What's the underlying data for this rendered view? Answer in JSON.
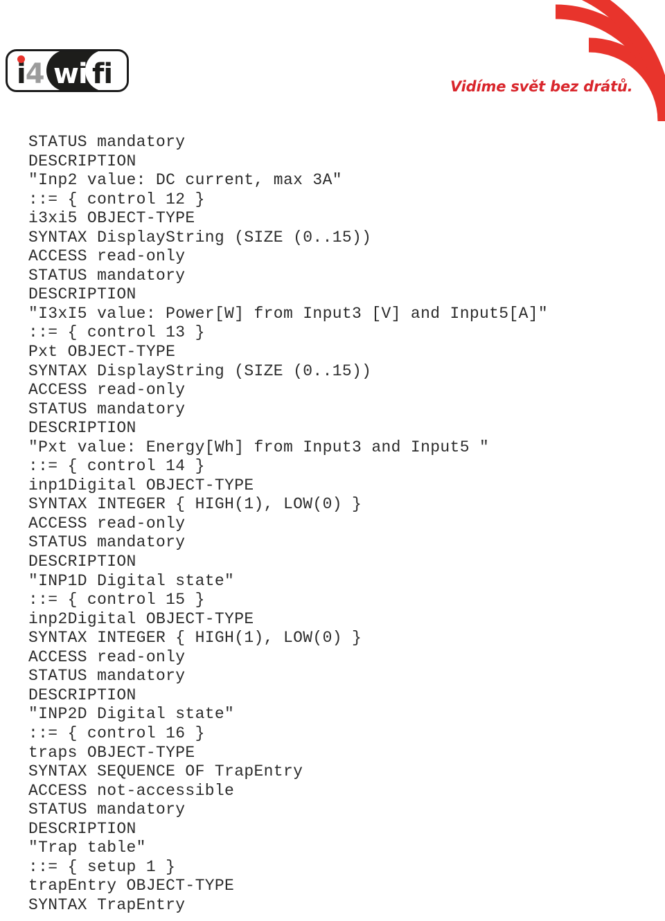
{
  "header": {
    "logo": {
      "name": "i4wifi-logo",
      "part_i4": "i4",
      "part_wi": "wi",
      "part_fi": "fi"
    },
    "tagline": "Vidíme svět bez drátů.",
    "wifi_icon_name": "wifi-arcs-icon",
    "accent_color": "#d9262c",
    "logo_dark_color": "#1d1d1b",
    "logo_gray_color": "#9b9b9b"
  },
  "document": {
    "listing_lines": [
      "STATUS mandatory",
      "DESCRIPTION",
      "\"Inp2 value: DC current, max 3A\"",
      "::= { control 12 }",
      "i3xi5 OBJECT-TYPE",
      "SYNTAX DisplayString (SIZE (0..15))",
      "ACCESS read-only",
      "STATUS mandatory",
      "DESCRIPTION",
      "\"I3xI5 value: Power[W] from Input3 [V] and Input5[A]\"",
      "::= { control 13 }",
      "Pxt OBJECT-TYPE",
      "SYNTAX DisplayString (SIZE (0..15))",
      "ACCESS read-only",
      "STATUS mandatory",
      "DESCRIPTION",
      "\"Pxt value: Energy[Wh] from Input3 and Input5 \"",
      "::= { control 14 }",
      "inp1Digital OBJECT-TYPE",
      "SYNTAX INTEGER { HIGH(1), LOW(0) }",
      "ACCESS read-only",
      "STATUS mandatory",
      "DESCRIPTION",
      "\"INP1D Digital state\"",
      "::= { control 15 }",
      "inp2Digital OBJECT-TYPE",
      "SYNTAX INTEGER { HIGH(1), LOW(0) }",
      "ACCESS read-only",
      "STATUS mandatory",
      "DESCRIPTION",
      "\"INP2D Digital state\"",
      "::= { control 16 }",
      "traps OBJECT-TYPE",
      "SYNTAX SEQUENCE OF TrapEntry",
      "ACCESS not-accessible",
      "STATUS mandatory",
      "DESCRIPTION",
      "\"Trap table\"",
      "::= { setup 1 }",
      "trapEntry OBJECT-TYPE",
      "SYNTAX TrapEntry"
    ]
  }
}
